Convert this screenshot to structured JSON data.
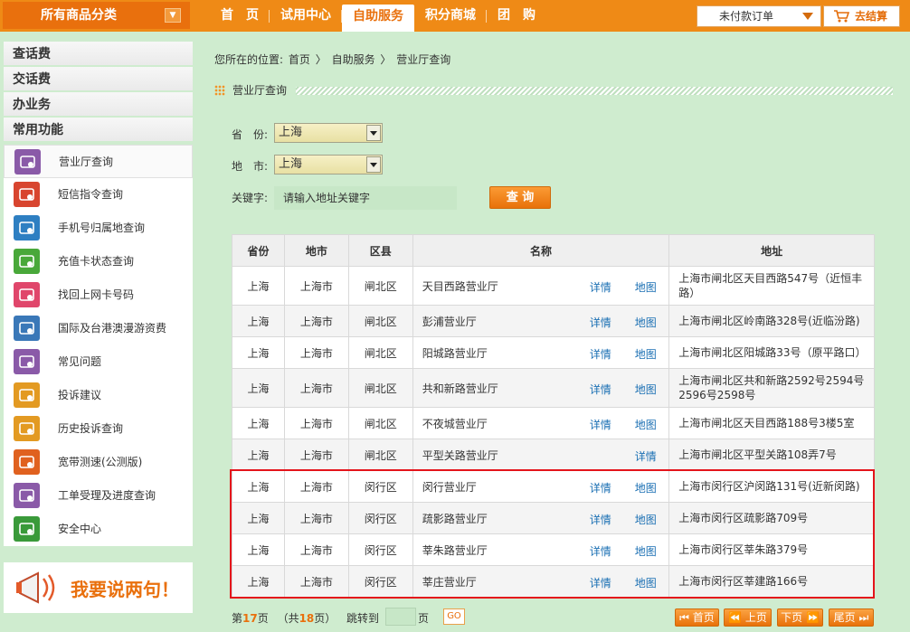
{
  "topnav": {
    "all_categories": "所有商品分类",
    "items": [
      "首　页",
      "试用中心",
      "自助服务",
      "积分商城",
      "团　购"
    ],
    "unpaid_orders": "未付款订单",
    "checkout": "去结算"
  },
  "sidebar": {
    "heads": [
      "查话费",
      "交话费",
      "办业务",
      "常用功能"
    ],
    "items": [
      {
        "label": "营业厅查询",
        "color": "#8a5aa8"
      },
      {
        "label": "短信指令查询",
        "color": "#d8452f"
      },
      {
        "label": "手机号归属地查询",
        "color": "#2e7fc2"
      },
      {
        "label": "充值卡状态查询",
        "color": "#49a83a"
      },
      {
        "label": "找回上网卡号码",
        "color": "#e0466b"
      },
      {
        "label": "国际及台港澳漫游资费",
        "color": "#3a78b8"
      },
      {
        "label": "常见问题",
        "color": "#8a5aa8"
      },
      {
        "label": "投诉建议",
        "color": "#e39a22"
      },
      {
        "label": "历史投诉查询",
        "color": "#e39a22"
      },
      {
        "label": "宽带测速(公测版)",
        "color": "#e0611f"
      },
      {
        "label": "工单受理及进度查询",
        "color": "#8a5aa8"
      },
      {
        "label": "安全中心",
        "color": "#3a9a3a"
      }
    ],
    "banner": "我要说两句！"
  },
  "breadcrumb": {
    "prefix": "您所在的位置:",
    "home": "首页",
    "sep": "〉",
    "level1": "自助服务",
    "level2": "营业厅查询"
  },
  "section_title": "营业厅查询",
  "form": {
    "province_label": "省　份:",
    "province_value": "上海",
    "city_label": "地　市:",
    "city_value": "上海",
    "keyword_label": "关键字:",
    "keyword_placeholder": "请输入地址关键字",
    "query_button": "查 询"
  },
  "table": {
    "headers": [
      "省份",
      "地市",
      "区县",
      "名称",
      "地址"
    ],
    "detail_label": "详情",
    "map_label": "地图",
    "rows": [
      {
        "province": "上海",
        "city": "上海市",
        "district": "闸北区",
        "name": "天目西路营业厅",
        "has_map": true,
        "address": "上海市闸北区天目西路547号（近恒丰路）"
      },
      {
        "province": "上海",
        "city": "上海市",
        "district": "闸北区",
        "name": "彭浦营业厅",
        "has_map": true,
        "address": "上海市闸北区岭南路328号(近临汾路)"
      },
      {
        "province": "上海",
        "city": "上海市",
        "district": "闸北区",
        "name": "阳城路营业厅",
        "has_map": true,
        "address": "上海市闸北区阳城路33号（原平路口）"
      },
      {
        "province": "上海",
        "city": "上海市",
        "district": "闸北区",
        "name": "共和新路营业厅",
        "has_map": true,
        "address": "上海市闸北区共和新路2592号2594号2596号2598号"
      },
      {
        "province": "上海",
        "city": "上海市",
        "district": "闸北区",
        "name": "不夜城营业厅",
        "has_map": true,
        "address": "上海市闸北区天目西路188号3楼5室"
      },
      {
        "province": "上海",
        "city": "上海市",
        "district": "闸北区",
        "name": "平型关路营业厅",
        "has_map": false,
        "address": "上海市闸北区平型关路108弄7号"
      },
      {
        "province": "上海",
        "city": "上海市",
        "district": "闵行区",
        "name": "闵行营业厅",
        "has_map": true,
        "address": "上海市闵行区沪闵路131号(近新闵路)"
      },
      {
        "province": "上海",
        "city": "上海市",
        "district": "闵行区",
        "name": "疏影路营业厅",
        "has_map": true,
        "address": "上海市闵行区疏影路709号"
      },
      {
        "province": "上海",
        "city": "上海市",
        "district": "闵行区",
        "name": "莘朱路营业厅",
        "has_map": true,
        "address": "上海市闵行区莘朱路379号"
      },
      {
        "province": "上海",
        "city": "上海市",
        "district": "闵行区",
        "name": "莘庄营业厅",
        "has_map": true,
        "address": "上海市闵行区莘建路166号"
      }
    ]
  },
  "pager": {
    "page_prefix": "第",
    "current_page": "17",
    "page_suffix": "页",
    "total_prefix": "（共",
    "total_pages": "18",
    "total_suffix": "页）",
    "jump_label": "跳转到",
    "jump_suffix": "页",
    "go": "GO",
    "first": "首页",
    "prev": "上页",
    "next": "下页",
    "last": "尾页"
  }
}
